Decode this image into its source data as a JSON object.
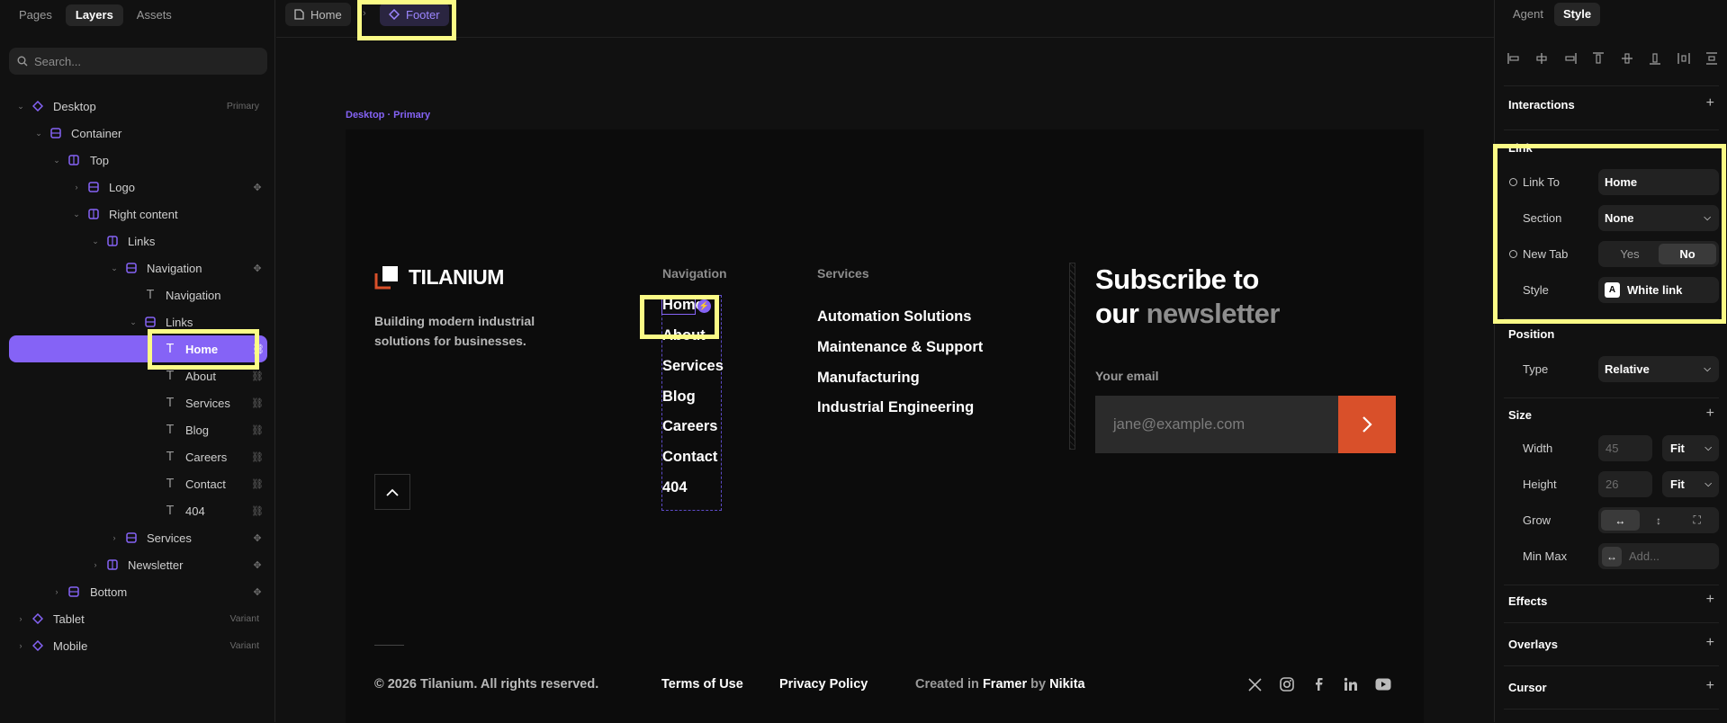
{
  "left_panel": {
    "tabs": [
      "Pages",
      "Layers",
      "Assets"
    ],
    "search_placeholder": "Search...",
    "layers": [
      {
        "label": "Desktop",
        "tag": "Primary"
      },
      {
        "label": "Container"
      },
      {
        "label": "Top"
      },
      {
        "label": "Logo"
      },
      {
        "label": "Right content"
      },
      {
        "label": "Links"
      },
      {
        "label": "Navigation"
      },
      {
        "label": "Navigation"
      },
      {
        "label": "Links"
      },
      {
        "label": "Home"
      },
      {
        "label": "About"
      },
      {
        "label": "Services"
      },
      {
        "label": "Blog"
      },
      {
        "label": "Careers"
      },
      {
        "label": "Contact"
      },
      {
        "label": "404"
      },
      {
        "label": "Services"
      },
      {
        "label": "Newsletter"
      },
      {
        "label": "Bottom"
      },
      {
        "label": "Tablet",
        "tag": "Variant"
      },
      {
        "label": "Mobile",
        "tag": "Variant"
      }
    ]
  },
  "topbar": {
    "crumbs": [
      "Home",
      "Footer"
    ]
  },
  "canvas": {
    "frame_label": "Desktop · Primary",
    "brand": "TILANIUM",
    "tagline": "Building modern industrial solutions for businesses.",
    "nav_heading": "Navigation",
    "nav_links": [
      "Home",
      "About",
      "Services",
      "Blog",
      "Careers",
      "Contact",
      "404"
    ],
    "services_heading": "Services",
    "services_links": [
      "Automation Solutions",
      "Maintenance & Support",
      "Manufacturing",
      "Industrial Engineering"
    ],
    "subscribe_line1": "Subscribe to",
    "subscribe_our": "our",
    "subscribe_newsletter": "newsletter",
    "email_label": "Your email",
    "email_placeholder": "jane@example.com",
    "copyright": "© 2026 Tilanium. All rights reserved.",
    "terms": "Terms of Use",
    "privacy": "Privacy Policy",
    "credit_prefix": "Created in",
    "credit_tool": "Framer",
    "credit_by": "by",
    "credit_author": "Nikita",
    "socials": [
      "x-icon",
      "instagram-icon",
      "facebook-icon",
      "linkedin-icon",
      "youtube-icon"
    ],
    "accent": "#d9502a"
  },
  "right_panel": {
    "tabs": [
      "Agent",
      "Style"
    ],
    "interactions": "Interactions",
    "link_section": "Link",
    "link_to_label": "Link To",
    "link_to_value": "Home",
    "section_label": "Section",
    "section_value": "None",
    "new_tab_label": "New Tab",
    "new_tab_yes": "Yes",
    "new_tab_no": "No",
    "style_label": "Style",
    "style_value": "White link",
    "style_badge": "A",
    "position_title": "Position",
    "type_label": "Type",
    "type_value": "Relative",
    "size_title": "Size",
    "width_label": "Width",
    "width_value": "45",
    "width_mode": "Fit",
    "height_label": "Height",
    "height_value": "26",
    "height_mode": "Fit",
    "grow_label": "Grow",
    "minmax_label": "Min Max",
    "minmax_placeholder": "Add...",
    "effects": "Effects",
    "overlays": "Overlays",
    "cursor": "Cursor"
  },
  "colors": {
    "selection": "#8563f6",
    "highlight": "#fbfb86",
    "panel_bg": "#111111"
  }
}
